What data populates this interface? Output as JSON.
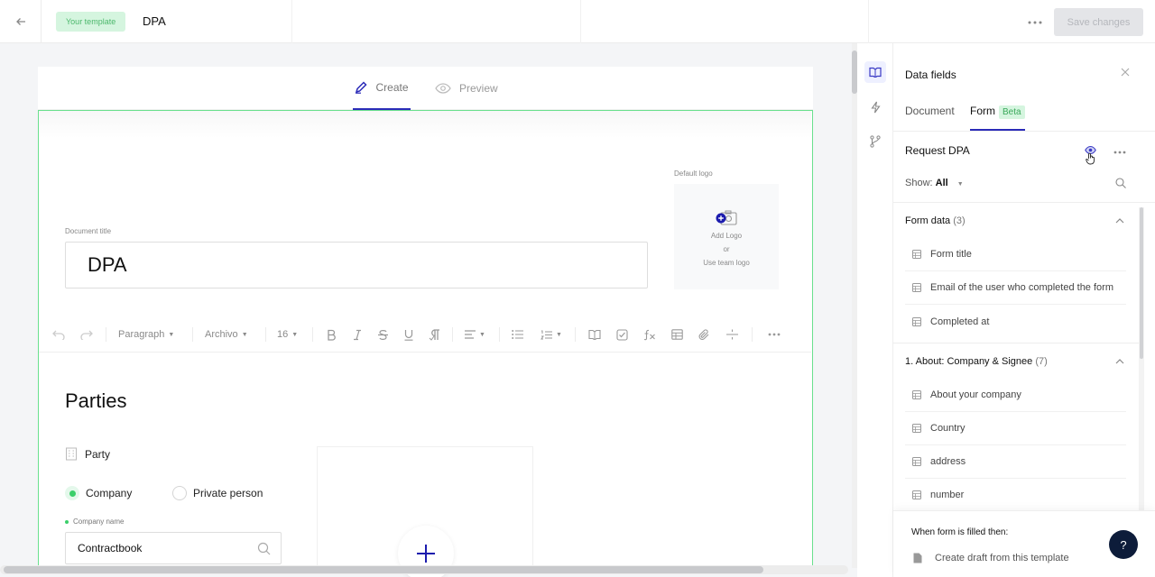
{
  "header": {
    "back_icon": "arrow-left-icon",
    "template_badge": "Your template",
    "document_name": "DPA",
    "more_icon": "more-horizontal-icon",
    "save_label": "Save changes"
  },
  "editor_tabs": [
    {
      "label": "Create",
      "icon": "pencil-icon",
      "active": true
    },
    {
      "label": "Preview",
      "icon": "eye-icon",
      "active": false
    }
  ],
  "document": {
    "logo_label": "Default logo",
    "add_logo": "Add Logo",
    "or": "or",
    "use_team_logo": "Use team logo",
    "title_label": "Document title",
    "title_value": "DPA"
  },
  "toolbar": {
    "paragraph": "Paragraph",
    "font": "Archivo",
    "size": "16"
  },
  "content": {
    "heading": "Parties",
    "party_label": "Party",
    "radio_company": "Company",
    "radio_private": "Private person",
    "company_name_label": "Company name",
    "company_name_value": "Contractbook"
  },
  "panel": {
    "title": "Data fields",
    "tabs": {
      "document": "Document",
      "form": "Form",
      "beta": "Beta"
    },
    "request_title": "Request DPA",
    "show_label": "Show:",
    "show_value": "All",
    "sections": [
      {
        "title": "Form data",
        "count": "(3)",
        "items": [
          "Form title",
          "Email of the user who completed the form",
          "Completed at"
        ]
      },
      {
        "title": "1. About: Company & Signee",
        "count": "(7)",
        "items": [
          "About your company",
          "Country",
          "address",
          "number"
        ]
      }
    ],
    "bottom_title": "When form is filled then:",
    "bottom_action": "Create draft from this template",
    "help_label": "?"
  },
  "colors": {
    "accent": "#2b2bb8",
    "green": "#3bcf6a",
    "green_border": "#6ae08e",
    "help_bg": "#0d1c3a"
  }
}
